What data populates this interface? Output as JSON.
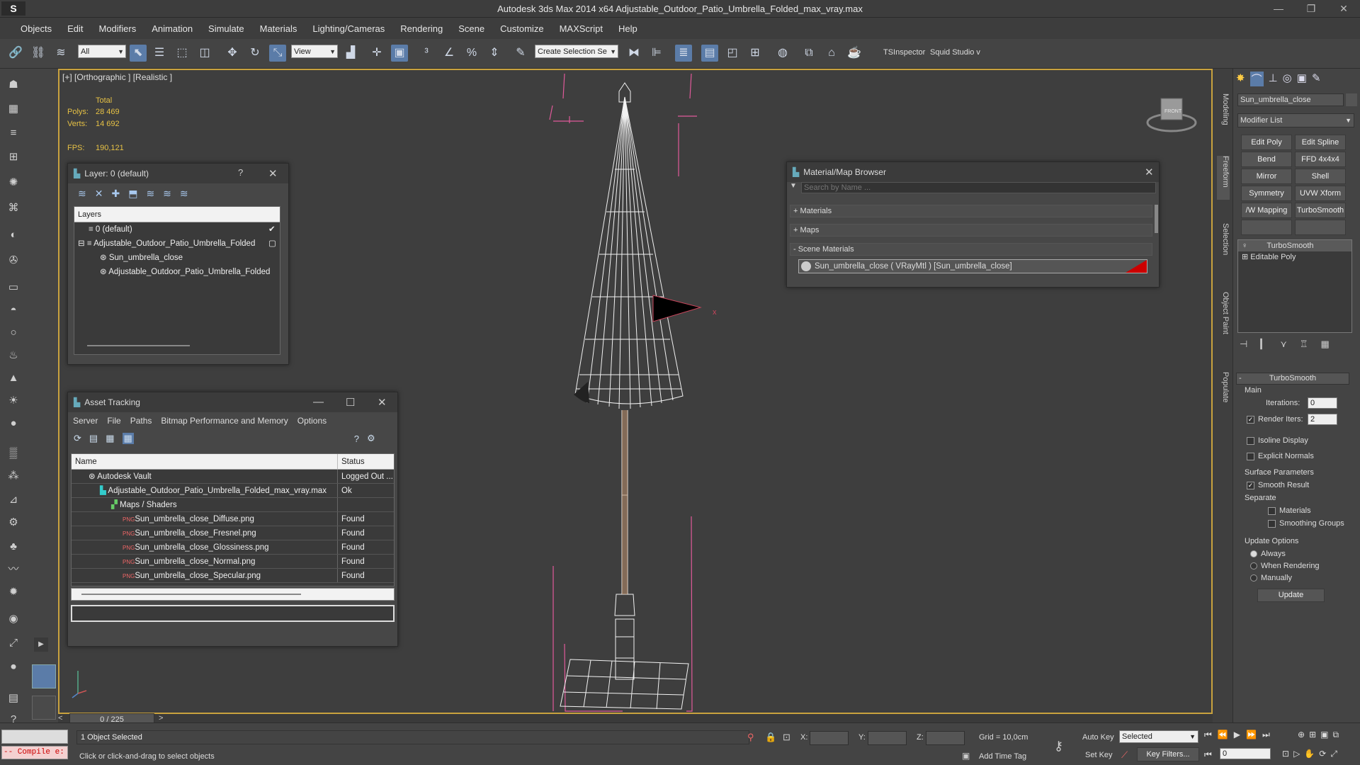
{
  "app": {
    "logo": "S",
    "title": "Autodesk 3ds Max  2014 x64     Adjustable_Outdoor_Patio_Umbrella_Folded_max_vray.max",
    "win_min": "—",
    "win_max": "❐",
    "win_close": "✕"
  },
  "menu": [
    "Objects",
    "Edit",
    "Modifiers",
    "Animation",
    "Simulate",
    "Materials",
    "Lighting/Cameras",
    "Rendering",
    "Scene",
    "Customize",
    "MAXScript",
    "Help"
  ],
  "toolbar": {
    "filter": "All",
    "refcoord": "View",
    "selection_set": "Create Selection Se",
    "tsinspector": "TSInspector",
    "squid": "Squid Studio v"
  },
  "viewport": {
    "label": "[+] [Orthographic ] [Realistic ]",
    "stats_total": "Total",
    "polys_label": "Polys:",
    "polys_value": "28 469",
    "verts_label": "Verts:",
    "verts_value": "14 692",
    "fps_label": "FPS:",
    "fps_value": "190,121",
    "x_axis": "x",
    "viewcube_face": "FRONT"
  },
  "layer_panel": {
    "title": "Layer: 0 (default)",
    "help": "?",
    "close": "✕",
    "header": "Layers",
    "rows": [
      {
        "label": "0 (default)",
        "indent": 0
      },
      {
        "label": "Adjustable_Outdoor_Patio_Umbrella_Folded",
        "indent": 0
      },
      {
        "label": "Sun_umbrella_close",
        "indent": 1
      },
      {
        "label": "Adjustable_Outdoor_Patio_Umbrella_Folded",
        "indent": 1
      }
    ]
  },
  "asset_panel": {
    "title": "Asset Tracking",
    "menu": [
      "Server",
      "File",
      "Paths",
      "Bitmap Performance and Memory",
      "Options"
    ],
    "col_name": "Name",
    "col_status": "Status",
    "rows": [
      {
        "name": "Autodesk Vault",
        "status": "Logged Out ...",
        "indent": 1
      },
      {
        "name": "Adjustable_Outdoor_Patio_Umbrella_Folded_max_vray.max",
        "status": "Ok",
        "indent": 2
      },
      {
        "name": "Maps / Shaders",
        "status": "",
        "indent": 3
      },
      {
        "name": "Sun_umbrella_close_Diffuse.png",
        "status": "Found",
        "indent": 4
      },
      {
        "name": "Sun_umbrella_close_Fresnel.png",
        "status": "Found",
        "indent": 4
      },
      {
        "name": "Sun_umbrella_close_Glossiness.png",
        "status": "Found",
        "indent": 4
      },
      {
        "name": "Sun_umbrella_close_Normal.png",
        "status": "Found",
        "indent": 4
      },
      {
        "name": "Sun_umbrella_close_Specular.png",
        "status": "Found",
        "indent": 4
      }
    ]
  },
  "material_browser": {
    "title": "Material/Map Browser",
    "search_placeholder": "Search by Name ...",
    "sec_materials": "+ Materials",
    "sec_maps": "+ Maps",
    "sec_scene": "- Scene Materials",
    "scene_item": "Sun_umbrella_close  ( VRayMtl ) [Sun_umbrella_close]"
  },
  "command_panel": {
    "object_name": "Sun_umbrella_close",
    "modifier_list": "Modifier List",
    "mod_buttons": [
      "Edit Poly",
      "Edit Spline",
      "Bend",
      "FFD 4x4x4",
      "Mirror",
      "Shell",
      "Symmetry",
      "UVW Xform",
      "/W Mapping Ac",
      "TurboSmooth"
    ],
    "stack": [
      "TurboSmooth",
      "Editable Poly"
    ],
    "rollout_title": "TurboSmooth",
    "main_label": "Main",
    "iterations_label": "Iterations:",
    "iterations_value": "0",
    "render_iters_label": "Render Iters:",
    "render_iters_value": "2",
    "isoline": "Isoline Display",
    "explicit": "Explicit Normals",
    "surface_params": "Surface Parameters",
    "smooth_result": "Smooth Result",
    "separate": "Separate",
    "materials": "Materials",
    "smoothing_groups": "Smoothing Groups",
    "update_options": "Update Options",
    "always": "Always",
    "when_rendering": "When Rendering",
    "manually": "Manually",
    "update_btn": "Update"
  },
  "side_tabs": [
    "Modeling",
    "Freeform",
    "Selection",
    "Object Paint",
    "Populate"
  ],
  "timeline": {
    "frame": "0 / 225",
    "prev": "<",
    "next": ">"
  },
  "status": {
    "maxscript": "-- Compile e:",
    "selected": "1 Object Selected",
    "prompt": "Click or click-and-drag to select objects",
    "x_label": "X:",
    "y_label": "Y:",
    "z_label": "Z:",
    "grid": "Grid = 10,0cm",
    "add_time_tag": "Add Time Tag",
    "auto_key": "Auto Key",
    "set_key": "Set Key",
    "key_dd": "Selected",
    "key_filters": "Key Filters...",
    "frame_value": "0"
  },
  "colors": {
    "accent": "#5b7ca8",
    "viewport_border": "#c9a23e",
    "stats": "#e6c145",
    "bbox": "#e05a9a"
  }
}
